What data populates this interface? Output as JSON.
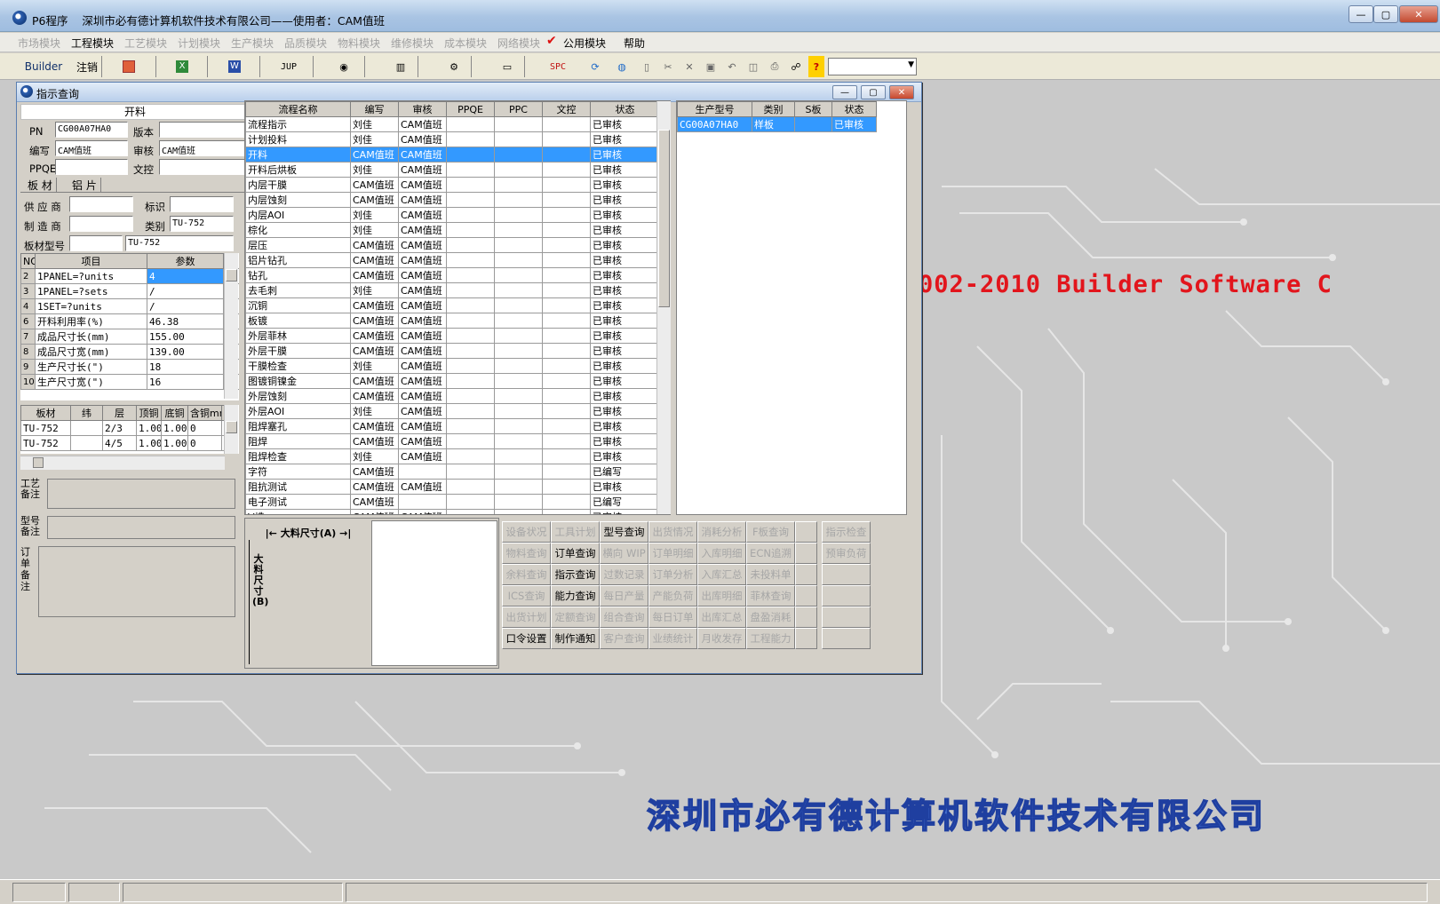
{
  "titlebar": {
    "app": "P6程序",
    "company_user": "深圳市必有德计算机软件技术有限公司——使用者：CAM值班"
  },
  "menu": [
    {
      "label": "市场模块",
      "disabled": true
    },
    {
      "label": "工程模块",
      "disabled": false
    },
    {
      "label": "工艺模块",
      "disabled": true
    },
    {
      "label": "计划模块",
      "disabled": true
    },
    {
      "label": "生产模块",
      "disabled": true
    },
    {
      "label": "品质模块",
      "disabled": true
    },
    {
      "label": "物料模块",
      "disabled": true
    },
    {
      "label": "维修模块",
      "disabled": true
    },
    {
      "label": "成本模块",
      "disabled": true
    },
    {
      "label": "网络模块",
      "disabled": true
    },
    {
      "label": "公用模块",
      "disabled": false
    },
    {
      "label": "帮助",
      "disabled": false
    }
  ],
  "toolbar": {
    "builder": "Builder",
    "logout": "注销",
    "jup": "JUP",
    "spc": "SPC",
    "help": "?"
  },
  "dialog": {
    "title": "指示查询",
    "section_title": "开料",
    "fields": {
      "pn_label": "PN",
      "pn_value": "CG00A07HA0",
      "version_label": "版本",
      "version_value": "",
      "writer_label": "编写",
      "writer_value": "CAM值班",
      "reviewer_label": "审核",
      "reviewer_value": "CAM值班",
      "ppqe_label": "PPQE",
      "ppqe_value": "",
      "doc_label": "文控",
      "doc_value": ""
    },
    "tabs": [
      "板 材",
      "铝 片"
    ],
    "material": {
      "supplier_label": "供 应 商",
      "supplier_value": "",
      "mark_label": "标识",
      "mark_value": "",
      "maker_label": "制 造 商",
      "maker_value": "",
      "type_label": "类别",
      "type_value": "TU-752",
      "model_label": "板材型号",
      "model_value": "",
      "model_value2": "TU-752"
    },
    "params": {
      "headers": [
        "NO",
        "项目",
        "参数"
      ],
      "rows": [
        [
          "2",
          "1PANEL=?units",
          "4"
        ],
        [
          "3",
          "1PANEL=?sets",
          "/"
        ],
        [
          "4",
          "1SET=?units",
          "/"
        ],
        [
          "6",
          "开料利用率(%)",
          "46.38"
        ],
        [
          "7",
          "成品尺寸长(mm)",
          "155.00"
        ],
        [
          "8",
          "成品尺寸宽(mm)",
          "139.00"
        ],
        [
          "9",
          "生产尺寸长(\")",
          "18"
        ],
        [
          "10",
          "生产尺寸宽(\")",
          "16"
        ]
      ]
    },
    "layers": {
      "headers": [
        "板材",
        "纬",
        "层",
        "顶铜",
        "底铜",
        "含铜mm"
      ],
      "rows": [
        [
          "TU-752",
          "",
          "2/3",
          "1.00",
          "1.00",
          "0"
        ],
        [
          "TU-752",
          "",
          "4/5",
          "1.00",
          "1.00",
          "0"
        ]
      ]
    },
    "notes": {
      "process": "工艺\n备注",
      "model": "型号\n备注",
      "order": "订单备注"
    },
    "flow": {
      "headers": [
        "流程名称",
        "编写",
        "审核",
        "PPQE",
        "PPC",
        "文控",
        "状态"
      ],
      "selected": 2,
      "rows": [
        [
          "流程指示",
          "刘佳",
          "CAM值班",
          "",
          "",
          "",
          "已审核"
        ],
        [
          "计划投料",
          "刘佳",
          "CAM值班",
          "",
          "",
          "",
          "已审核"
        ],
        [
          "开料",
          "CAM值班",
          "CAM值班",
          "",
          "",
          "",
          "已审核"
        ],
        [
          "开料后烘板",
          "刘佳",
          "CAM值班",
          "",
          "",
          "",
          "已审核"
        ],
        [
          "内层干膜",
          "CAM值班",
          "CAM值班",
          "",
          "",
          "",
          "已审核"
        ],
        [
          "内层蚀刻",
          "CAM值班",
          "CAM值班",
          "",
          "",
          "",
          "已审核"
        ],
        [
          "内层AOI",
          "刘佳",
          "CAM值班",
          "",
          "",
          "",
          "已审核"
        ],
        [
          "棕化",
          "刘佳",
          "CAM值班",
          "",
          "",
          "",
          "已审核"
        ],
        [
          "层压",
          "CAM值班",
          "CAM值班",
          "",
          "",
          "",
          "已审核"
        ],
        [
          "铝片钻孔",
          "CAM值班",
          "CAM值班",
          "",
          "",
          "",
          "已审核"
        ],
        [
          "钻孔",
          "CAM值班",
          "CAM值班",
          "",
          "",
          "",
          "已审核"
        ],
        [
          "去毛刺",
          "刘佳",
          "CAM值班",
          "",
          "",
          "",
          "已审核"
        ],
        [
          "沉铜",
          "CAM值班",
          "CAM值班",
          "",
          "",
          "",
          "已审核"
        ],
        [
          "板镀",
          "CAM值班",
          "CAM值班",
          "",
          "",
          "",
          "已审核"
        ],
        [
          "外层菲林",
          "CAM值班",
          "CAM值班",
          "",
          "",
          "",
          "已审核"
        ],
        [
          "外层干膜",
          "CAM值班",
          "CAM值班",
          "",
          "",
          "",
          "已审核"
        ],
        [
          "干膜检查",
          "刘佳",
          "CAM值班",
          "",
          "",
          "",
          "已审核"
        ],
        [
          "图镀铜镍金",
          "CAM值班",
          "CAM值班",
          "",
          "",
          "",
          "已审核"
        ],
        [
          "外层蚀刻",
          "CAM值班",
          "CAM值班",
          "",
          "",
          "",
          "已审核"
        ],
        [
          "外层AOI",
          "刘佳",
          "CAM值班",
          "",
          "",
          "",
          "已审核"
        ],
        [
          "阻焊塞孔",
          "CAM值班",
          "CAM值班",
          "",
          "",
          "",
          "已审核"
        ],
        [
          "阻焊",
          "CAM值班",
          "CAM值班",
          "",
          "",
          "",
          "已审核"
        ],
        [
          "阻焊检查",
          "刘佳",
          "CAM值班",
          "",
          "",
          "",
          "已审核"
        ],
        [
          "字符",
          "CAM值班",
          "",
          "",
          "",
          "",
          "已编写"
        ],
        [
          "阻抗测试",
          "CAM值班",
          "CAM值班",
          "",
          "",
          "",
          "已审核"
        ],
        [
          "电子测试",
          "CAM值班",
          "",
          "",
          "",
          "",
          "已编写"
        ],
        [
          "V槽",
          "CAM值班",
          "CAM值班",
          "",
          "",
          "",
          "已审核"
        ]
      ]
    },
    "product": {
      "headers": [
        "生产型号",
        "类别",
        "S板",
        "状态"
      ],
      "rows": [
        [
          "CG00A07HA0",
          "样板",
          "",
          "已审核"
        ]
      ]
    },
    "size_a": "大料尺寸(A)",
    "size_b": "大料尺寸(B)",
    "funcs": [
      [
        {
          "t": "设备状况",
          "d": true
        },
        {
          "t": "工具计划",
          "d": true
        },
        {
          "t": "型号查询",
          "d": false
        },
        {
          "t": "出货情况",
          "d": true
        },
        {
          "t": "消耗分析",
          "d": true
        },
        {
          "t": "F板查询",
          "d": true
        },
        {
          "t": "",
          "d": true
        },
        {
          "t": "指示检查",
          "d": true
        }
      ],
      [
        {
          "t": "物料查询",
          "d": true
        },
        {
          "t": "订单查询",
          "d": false
        },
        {
          "t": "横向 WIP",
          "d": true
        },
        {
          "t": "订单明细",
          "d": true
        },
        {
          "t": "入库明细",
          "d": true
        },
        {
          "t": "ECN追溯",
          "d": true
        },
        {
          "t": "",
          "d": true
        },
        {
          "t": "预审负荷",
          "d": true
        }
      ],
      [
        {
          "t": "余料查询",
          "d": true
        },
        {
          "t": "指示查询",
          "d": false
        },
        {
          "t": "过数记录",
          "d": true
        },
        {
          "t": "订单分析",
          "d": true
        },
        {
          "t": "入库汇总",
          "d": true
        },
        {
          "t": "未投料单",
          "d": true
        },
        {
          "t": "",
          "d": true
        },
        {
          "t": "",
          "d": true
        }
      ],
      [
        {
          "t": "ICS查询",
          "d": true
        },
        {
          "t": "能力查询",
          "d": false
        },
        {
          "t": "每日产量",
          "d": true
        },
        {
          "t": "产能负荷",
          "d": true
        },
        {
          "t": "出库明细",
          "d": true
        },
        {
          "t": "菲林查询",
          "d": true
        },
        {
          "t": "",
          "d": true
        },
        {
          "t": "",
          "d": true
        }
      ],
      [
        {
          "t": "出货计划",
          "d": true
        },
        {
          "t": "定额查询",
          "d": true
        },
        {
          "t": "组合查询",
          "d": true
        },
        {
          "t": "每日订单",
          "d": true
        },
        {
          "t": "出库汇总",
          "d": true
        },
        {
          "t": "盘盈消耗",
          "d": true
        },
        {
          "t": "",
          "d": true
        },
        {
          "t": "",
          "d": true
        }
      ],
      [
        {
          "t": "口令设置",
          "d": false
        },
        {
          "t": "制作通知",
          "d": false
        },
        {
          "t": "客户查询",
          "d": true
        },
        {
          "t": "业绩统计",
          "d": true
        },
        {
          "t": "月收发存",
          "d": true
        },
        {
          "t": "工程能力",
          "d": true
        },
        {
          "t": "",
          "d": true
        },
        {
          "t": "",
          "d": true
        }
      ]
    ]
  },
  "desktop": {
    "watermark": "002-2010 Builder Software C",
    "company": "深圳市必有德计算机软件技术有限公司"
  }
}
